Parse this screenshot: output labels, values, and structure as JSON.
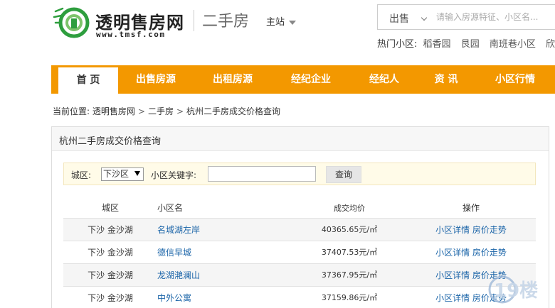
{
  "header": {
    "logo_cn": "透明售房网",
    "logo_en": "www.tmsf.com",
    "section": "二手房",
    "site_switch": "主站",
    "search": {
      "type": "出售",
      "placeholder": "请输入房源特征、小区名..."
    },
    "hot": {
      "label": "热门小区:",
      "items": [
        "稻香园",
        "艮园",
        "南班巷小区",
        "欣盛东"
      ]
    }
  },
  "nav": {
    "items": [
      "首 页",
      "出售房源",
      "出租房源",
      "经纪企业",
      "经纪人",
      "资 讯",
      "小区行情"
    ]
  },
  "breadcrumb": {
    "label": "当前位置:",
    "items": [
      "透明售房网",
      "二手房",
      "杭州二手房成交价格查询"
    ]
  },
  "panel": {
    "title": "杭州二手房成交价格查询",
    "filter": {
      "district_label": "城区:",
      "district_value": "下沙区",
      "keyword_label": "小区关键字:",
      "keyword_value": "",
      "search_button": "查询"
    },
    "table": {
      "headers": [
        "城区",
        "小区名",
        "成交均价",
        "操作"
      ],
      "rows": [
        {
          "area": "下沙 金沙湖",
          "name": "名城湖左岸",
          "price": "40365.65元/㎡",
          "op1": "小区详情",
          "op2": "房价走势"
        },
        {
          "area": "下沙 金沙湖",
          "name": "德信早城",
          "price": "37407.53元/㎡",
          "op1": "小区详情",
          "op2": "房价走势"
        },
        {
          "area": "下沙 金沙湖",
          "name": "龙湖滟澜山",
          "price": "37367.95元/㎡",
          "op1": "小区详情",
          "op2": "房价走势"
        },
        {
          "area": "下沙 金沙湖",
          "name": "中外公寓",
          "price": "37159.86元/㎡",
          "op1": "小区详情",
          "op2": "房价走势"
        }
      ]
    }
  },
  "watermark": "19楼",
  "colors": {
    "nav_bg": "#f39800",
    "link": "#1a64a8",
    "logo_green": "#2e9e3e"
  }
}
